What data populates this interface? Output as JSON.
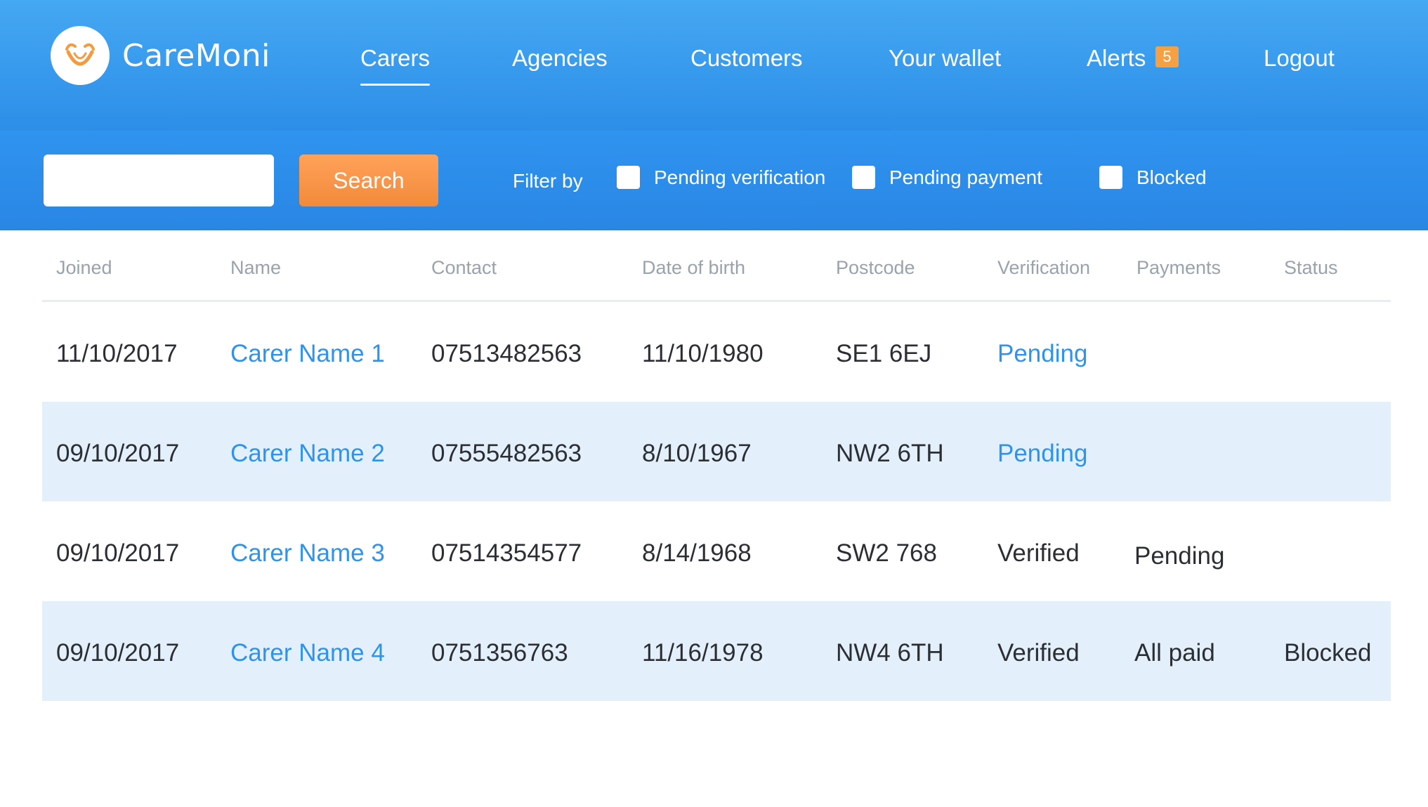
{
  "app": {
    "name": "CareMoni"
  },
  "nav": {
    "items": [
      {
        "label": "Carers"
      },
      {
        "label": "Agencies"
      },
      {
        "label": "Customers"
      },
      {
        "label": "Your wallet"
      },
      {
        "label": "Alerts",
        "badge": "5"
      },
      {
        "label": "Logout"
      }
    ],
    "active": "Carers"
  },
  "search": {
    "value": "",
    "button_label": "Search"
  },
  "filter": {
    "label": "Filter by",
    "options": [
      {
        "label": "Pending verification",
        "checked": false
      },
      {
        "label": "Pending payment",
        "checked": false
      },
      {
        "label": "Blocked",
        "checked": false
      }
    ]
  },
  "table": {
    "columns": [
      "Joined",
      "Name",
      "Contact",
      "Date of birth",
      "Postcode",
      "Verification",
      "Payments",
      "Status"
    ],
    "rows": [
      {
        "joined": "11/10/2017",
        "name": "Carer Name 1",
        "contact": "07513482563",
        "dob": "11/10/1980",
        "postcode": "SE1 6EJ",
        "verification": "Pending",
        "payments": "",
        "status": ""
      },
      {
        "joined": "09/10/2017",
        "name": "Carer Name 2",
        "contact": "07555482563",
        "dob": "8/10/1967",
        "postcode": "NW2 6TH",
        "verification": "Pending",
        "payments": "",
        "status": ""
      },
      {
        "joined": "09/10/2017",
        "name": "Carer Name 3",
        "contact": "07514354577",
        "dob": "8/14/1968",
        "postcode": "SW2 768",
        "verification": "Verified",
        "payments": "Pending",
        "status": ""
      },
      {
        "joined": "09/10/2017",
        "name": "Carer Name 4",
        "contact": "0751356763",
        "dob": "11/16/1978",
        "postcode": "NW4 6TH",
        "verification": "Verified",
        "payments": "All paid",
        "status": "Blocked"
      }
    ]
  },
  "colors": {
    "header_blue": "#3a9bf0",
    "link_blue": "#2f93ec",
    "search_orange": "#f5944a",
    "row_alt": "#e3f0fc",
    "badge_orange": "#f5a042"
  }
}
